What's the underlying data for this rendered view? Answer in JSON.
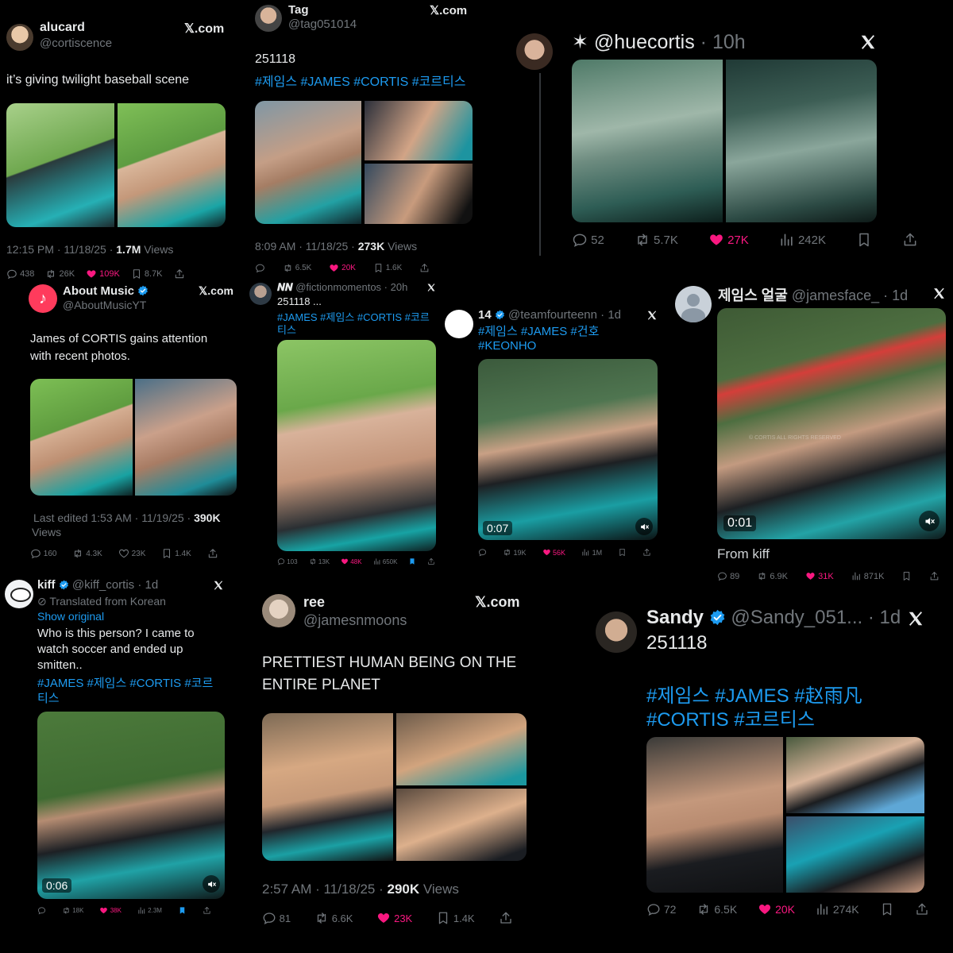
{
  "colors": {
    "bg": "#000000",
    "text": "#e7e9ea",
    "muted": "#71767b",
    "link": "#1d9bf0",
    "like": "#f91880",
    "verified": "#1d9bf0"
  },
  "p1": {
    "name": "alucard",
    "handle": "@cortiscence",
    "source": "𝕏.com",
    "text": "it’s giving twilight baseball scene",
    "time": "12:15 PM · 11/18/25 · ",
    "views_num": "1.7M",
    "views_word": " Views",
    "replies": "438",
    "reposts": "26K",
    "likes": "109K",
    "bookmarks": "8.7K"
  },
  "p2": {
    "name": "Tag",
    "handle": "@tag051014",
    "source": "𝕏.com",
    "text": "251118",
    "tags": "#제임스 #JAMES #CORTIS #코르티스",
    "time": "8:09 AM · 11/18/25 · ",
    "views_num": "273K",
    "views_word": " Views",
    "reposts": "6.5K",
    "likes": "20K",
    "bookmarks": "1.6K"
  },
  "p3": {
    "name": "✶ @huecortis",
    "time": "· 10h",
    "replies": "52",
    "reposts": "5.7K",
    "likes": "27K",
    "views": "242K"
  },
  "p4": {
    "name": "About Music",
    "handle": "@AboutMusicYT",
    "source": "𝕏.com",
    "text1": "James of CORTIS gains attention",
    "text2": "with recent photos.",
    "time": "Last edited 1:53 AM · 11/19/25 · ",
    "views_num": "390K",
    "views_word": "Views",
    "replies": "160",
    "reposts": "4.3K",
    "likes": "23K",
    "bookmarks": "1.4K"
  },
  "p5": {
    "name": "𝑵𝑵",
    "handle": "@fictionmomentos · 20h",
    "text": "251118 ...",
    "tags1": "#JAMES #제임스 #CORTIS #코르",
    "tags2": "티스",
    "replies": "103",
    "reposts": "13K",
    "likes": "48K",
    "views": "650K"
  },
  "p6": {
    "name": "14",
    "handle": "@teamfourteenn · 1d",
    "tags1": "#제임스 #JAMES #건호",
    "tags2": "#KEONHO",
    "duration": "0:07",
    "reposts": "19K",
    "likes": "56K",
    "views": "1M"
  },
  "p7": {
    "name": "제임스 얼굴",
    "handle": "@jamesface_ · 1d",
    "duration": "0:01",
    "watermark": "© CORTIS ALL RIGHTS RESERVED",
    "text": "From kiff",
    "replies": "89",
    "reposts": "6.9K",
    "likes": "31K",
    "views": "871K"
  },
  "p8": {
    "name": "kiff",
    "handle": "@kiff_cortis · 1d",
    "translated": "Translated from Korean",
    "show_original": "Show original",
    "text1": "Who is this person? I came to",
    "text2": "watch soccer and ended up",
    "text3": "smitten..",
    "tags1": "#JAMES #제임스 #CORTIS #코르",
    "tags2": "티스",
    "duration": "0:06",
    "reposts": "18K",
    "likes": "38K",
    "views": "2.3M"
  },
  "p9": {
    "name": "ree",
    "handle": "@jamesnmoons",
    "source": "𝕏.com",
    "text1": "PRETTIEST HUMAN BEING ON THE",
    "text2": "ENTIRE PLANET",
    "time": "2:57 AM · 11/18/25 · ",
    "views_num": "290K",
    "views_word": " Views",
    "replies": "81",
    "reposts": "6.6K",
    "likes": "23K",
    "bookmarks": "1.4K"
  },
  "p10": {
    "name": "Sandy",
    "handle": "@Sandy_051... · 1d",
    "text": "251118",
    "tags1": "#제임스 #JAMES #赵雨凡",
    "tags2": "#CORTIS #코르티스",
    "replies": "72",
    "reposts": "6.5K",
    "likes": "20K",
    "views": "274K"
  },
  "icons": [
    "reply-icon",
    "repost-icon",
    "heart-icon",
    "views-icon",
    "bookmark-icon",
    "share-icon",
    "x-logo-icon",
    "verified-icon",
    "volume-icon"
  ]
}
